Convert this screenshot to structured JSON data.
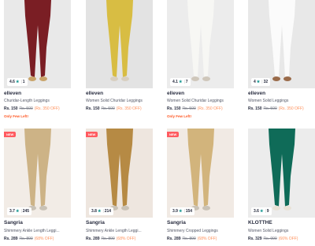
{
  "products": [
    {
      "brand": "elleven",
      "desc": "Churidar-Length Leggings",
      "rating": "4.6",
      "count": "1",
      "price": "Rs. 150",
      "mrp": "Rs. 500",
      "off": "(Rs. 350 OFF)",
      "few_left": "Only Few Left!",
      "tag": "",
      "bg": "#e9e9e9",
      "leg": "#7a1e24",
      "shoe": "#c9a46a"
    },
    {
      "brand": "elleven",
      "desc": "Women Solid Churidar Leggings",
      "rating": "",
      "count": "",
      "price": "Rs. 150",
      "mrp": "Rs. 500",
      "off": "(Rs. 350 OFF)",
      "few_left": "",
      "tag": "",
      "bg": "#e3e3e3",
      "leg": "#d8bd43",
      "shoe": "#d8cfc0"
    },
    {
      "brand": "elleven",
      "desc": "Women Solid Churidar Leggings",
      "rating": "4.1",
      "count": "7",
      "price": "Rs. 150",
      "mrp": "Rs. 500",
      "off": "(Rs. 350 OFF)",
      "few_left": "Only Few Left!",
      "tag": "",
      "bg": "#ececec",
      "leg": "#f7f7f4",
      "shoe": "#cfc7bb"
    },
    {
      "brand": "elleven",
      "desc": "Women Solid Leggings",
      "rating": "4",
      "count": "32",
      "price": "Rs. 150",
      "mrp": "Rs. 500",
      "off": "(Rs. 350 OFF)",
      "few_left": "",
      "tag": "",
      "bg": "#e8e8e8",
      "leg": "#fbfbfb",
      "shoe": "#9a6b4a"
    },
    {
      "brand": "Sangria",
      "desc": "Shimmery Ankle Length Leggi...",
      "rating": "3.7",
      "count": "245",
      "price": "Rs. 289",
      "mrp": "Rs. 899",
      "off": "(68% OFF)",
      "few_left": "",
      "tag": "NEW",
      "bg": "#f2ece6",
      "leg": "#cdb386",
      "shoe": "#c9c2b6"
    },
    {
      "brand": "Sangria",
      "desc": "Shimmery Ankle Length Leggi...",
      "rating": "3.8",
      "count": "214",
      "price": "Rs. 289",
      "mrp": "Rs. 899",
      "off": "(68% OFF)",
      "few_left": "",
      "tag": "NEW",
      "bg": "#eee6df",
      "leg": "#b68a44",
      "shoe": "#c9c2b6"
    },
    {
      "brand": "Sangria",
      "desc": "Shimmery Cropped Leggings",
      "rating": "3.9",
      "count": "154",
      "price": "Rs. 289",
      "mrp": "Rs. 899",
      "off": "(68% OFF)",
      "few_left": "",
      "tag": "NEW",
      "bg": "#f1eae4",
      "leg": "#d2b47c",
      "shoe": "#c9c2b6"
    },
    {
      "brand": "KLOTTHE",
      "desc": "Women Solid Leggings",
      "rating": "3.6",
      "count": "9",
      "price": "Rs. 329",
      "mrp": "Rs. 999",
      "off": "(66% OFF)",
      "few_left": "",
      "tag": "",
      "bg": "#ececec",
      "leg": "#0f6b58",
      "shoe": "#e9e2d6"
    }
  ]
}
